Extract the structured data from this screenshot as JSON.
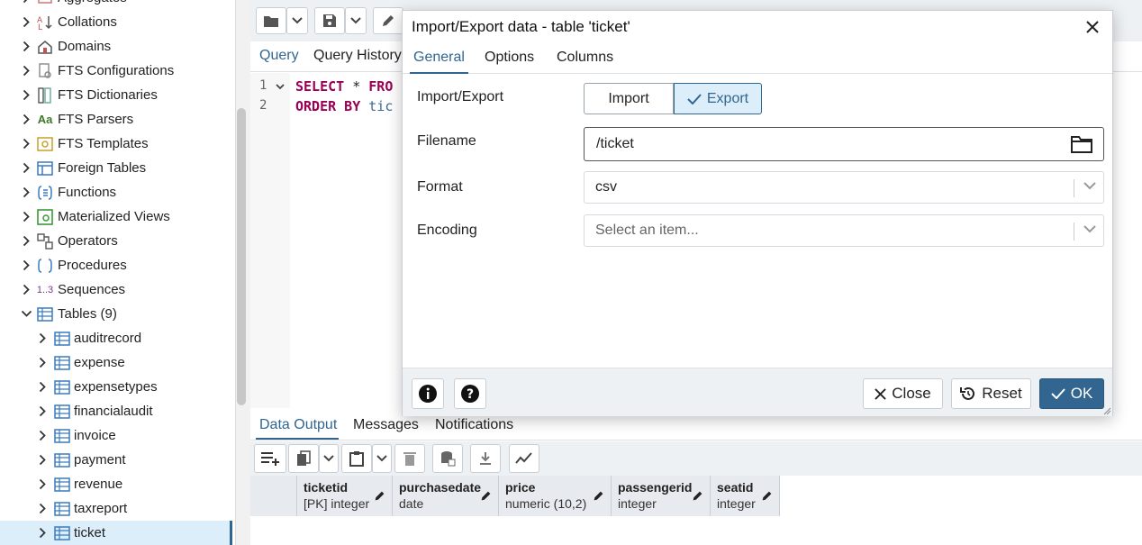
{
  "sidebar": {
    "items": [
      {
        "label": "Aggregates",
        "icon": "aggregate-icon"
      },
      {
        "label": "Collations",
        "icon": "collation-icon"
      },
      {
        "label": "Domains",
        "icon": "domain-icon"
      },
      {
        "label": "FTS Configurations",
        "icon": "fts-config-icon"
      },
      {
        "label": "FTS Dictionaries",
        "icon": "fts-dictionary-icon"
      },
      {
        "label": "FTS Parsers",
        "icon": "fts-parser-icon"
      },
      {
        "label": "FTS Templates",
        "icon": "fts-template-icon"
      },
      {
        "label": "Foreign Tables",
        "icon": "foreign-table-icon"
      },
      {
        "label": "Functions",
        "icon": "function-icon"
      },
      {
        "label": "Materialized Views",
        "icon": "materialized-view-icon"
      },
      {
        "label": "Operators",
        "icon": "operator-icon"
      },
      {
        "label": "Procedures",
        "icon": "procedure-icon"
      },
      {
        "label": "Sequences",
        "icon": "sequence-icon"
      },
      {
        "label": "Tables",
        "count": "(9)",
        "icon": "table-icon"
      }
    ],
    "tables": [
      "auditrecord",
      "expense",
      "expensetypes",
      "financialaudit",
      "invoice",
      "payment",
      "revenue",
      "taxreport",
      "ticket"
    ],
    "aa_glyph": "Aa",
    "seq_glyph": "1..3"
  },
  "query_tabs": [
    "Query",
    "Query History"
  ],
  "editor": {
    "lines": [
      {
        "num": "1",
        "kw": "SELECT",
        "rest": " * ",
        "kw2": "FRO"
      },
      {
        "num": "2",
        "kw": "ORDER BY",
        "rest": " ",
        "id": "tic"
      }
    ]
  },
  "output_tabs": [
    "Data Output",
    "Messages",
    "Notifications"
  ],
  "grid_columns": [
    {
      "name": "ticketid",
      "type": "[PK] integer"
    },
    {
      "name": "purchasedate",
      "type": "date"
    },
    {
      "name": "price",
      "type": "numeric (10,2)"
    },
    {
      "name": "passengerid",
      "type": "integer"
    },
    {
      "name": "seatid",
      "type": "integer"
    }
  ],
  "dialog": {
    "title": "Import/Export data - table 'ticket'",
    "tabs": [
      "General",
      "Options",
      "Columns"
    ],
    "import_export_label": "Import/Export",
    "import_label": "Import",
    "export_label": "Export",
    "selected_mode": "Export",
    "filename_label": "Filename",
    "filename_value": "/ticket",
    "format_label": "Format",
    "format_value": "csv",
    "encoding_label": "Encoding",
    "encoding_placeholder": "Select an item...",
    "close_label": "Close",
    "reset_label": "Reset",
    "ok_label": "OK"
  },
  "colors": {
    "accent": "#326690",
    "selected_bg": "#dbeefa"
  }
}
